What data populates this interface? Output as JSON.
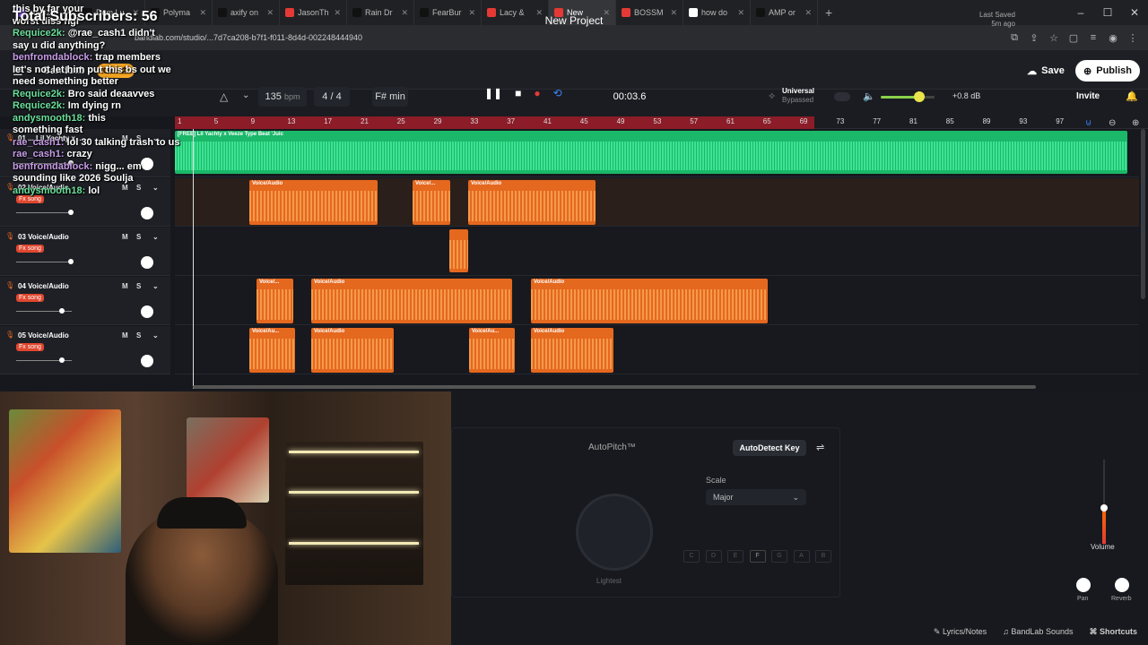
{
  "browser": {
    "tabs": [
      {
        "label": "Madi2h",
        "color": "#8b5cf6"
      },
      {
        "label": "Dom Lu",
        "color": "#111111"
      },
      {
        "label": "Polyma",
        "color": "#111111"
      },
      {
        "label": "axify on",
        "color": "#111111"
      },
      {
        "label": "JasonTh",
        "color": "#e53935"
      },
      {
        "label": "Rain Dr",
        "color": "#111111"
      },
      {
        "label": "FearBur",
        "color": "#111111"
      },
      {
        "label": "Lacy &",
        "color": "#e53935"
      },
      {
        "label": "New",
        "color": "#e53935",
        "active": true
      },
      {
        "label": "BOSSM",
        "color": "#e53935"
      },
      {
        "label": "how do",
        "color": "#ffffff"
      },
      {
        "label": "AMP or",
        "color": "#111111"
      }
    ],
    "url": "bandlab.com/studio/...7d7ca208-b7f1-f011-8d4d-002248444940"
  },
  "app": {
    "brand": "BandLab",
    "get_label": "Get",
    "project_title": "New Project",
    "last_saved_label": "Last Saved",
    "last_saved_time": "5m ago",
    "save_label": "Save",
    "publish_label": "Publish",
    "invite_label": "Invite"
  },
  "transport": {
    "bpm": "135",
    "bpm_unit": "bpm",
    "time_sig": "4 / 4",
    "key": "F# min",
    "timecode": "00:03.6",
    "universal_label": "Universal",
    "bypassed_label": "Bypassed",
    "master_db": "+0.8 dB",
    "master_volume": 0.72
  },
  "ruler": [
    "1",
    "5",
    "9",
    "13",
    "17",
    "21",
    "25",
    "29",
    "33",
    "37",
    "41",
    "45",
    "49",
    "53",
    "57",
    "61",
    "65",
    "69",
    "73",
    "77",
    "81",
    "85",
    "89",
    "93",
    "97"
  ],
  "tracks": [
    {
      "name": "01 ... Lil Yachty x ...",
      "fx": "",
      "clips": [
        {
          "label": "[FREE] Lil Yachty x Veeze Type Beat 'Juic",
          "green": true
        }
      ]
    },
    {
      "name": "02 Voice/Audio",
      "fx": "Fx song",
      "clips": [
        {
          "label": "Voice/Audio"
        },
        {
          "label": "Voice/..."
        },
        {
          "label": "Voice/Audio"
        }
      ]
    },
    {
      "name": "03 Voice/Audio",
      "fx": "Fx song",
      "clips": [
        {
          "label": ""
        }
      ]
    },
    {
      "name": "04 Voice/Audio",
      "fx": "Fx song",
      "clips": [
        {
          "label": "Voice/..."
        },
        {
          "label": "Voice/Audio"
        },
        {
          "label": "Voice/Audio"
        }
      ]
    },
    {
      "name": "05 Voice/Audio",
      "fx": "Fx song",
      "clips": [
        {
          "label": "Voice/Au..."
        },
        {
          "label": "Voice/Audio"
        },
        {
          "label": "Voice/Au..."
        },
        {
          "label": "Voice/Audio"
        }
      ]
    }
  ],
  "mute_label": "M",
  "solo_label": "S",
  "autopitch": {
    "title": "AutoPitch™",
    "autodetect_label": "AutoDetect Key",
    "scale_label": "Scale",
    "scale_value": "Major",
    "strength_label": "Lightest",
    "notes": [
      "C",
      "D",
      "E",
      "F",
      "G",
      "A",
      "B"
    ]
  },
  "mixer": {
    "volume_label": "Volume",
    "pan_label": "Pan",
    "reverb_label": "Reverb"
  },
  "footer": {
    "lyrics": "Lyrics/Notes",
    "sounds": "BandLab Sounds",
    "shortcuts": "Shortcuts"
  },
  "overlay": {
    "subscribers": "Total Subscribers: 56",
    "chat": [
      {
        "user": "",
        "text": "this by far your"
      },
      {
        "user": "",
        "text": "worst diss ngl"
      },
      {
        "user": "Requice2k:",
        "text": "@rae_cash1 didn't"
      },
      {
        "user": "",
        "text": "say u did anything?"
      },
      {
        "user": "benfromdablock:",
        "text": "trap members"
      },
      {
        "user": "",
        "text": "let's not let him put this bs out we"
      },
      {
        "user": "",
        "text": "need something better"
      },
      {
        "user": "Requice2k:",
        "text": "Bro said deaavves"
      },
      {
        "user": "Requice2k:",
        "text": "Im dying rn"
      },
      {
        "user": "andysmooth18:",
        "text": "this"
      },
      {
        "user": "",
        "text": "something fast"
      },
      {
        "user": "rae_cash1:",
        "text": "lol 30 talking trash to us"
      },
      {
        "user": "rae_cash1:",
        "text": "crazy"
      },
      {
        "user": "benfromdablock:",
        "text": "nigg... em"
      },
      {
        "user": "",
        "text": "sounding like 2026 Soulja"
      },
      {
        "user": "andysmooth18:",
        "text": "lol"
      }
    ]
  }
}
